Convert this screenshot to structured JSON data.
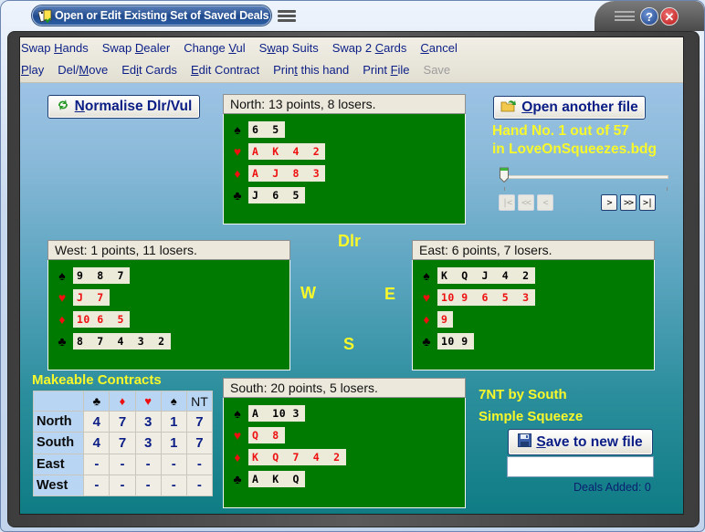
{
  "window": {
    "title": "Open or Edit Existing Set of Saved Deals",
    "help_label": "?",
    "close_label": "✕"
  },
  "menu": {
    "row1": [
      {
        "pre": "Swap ",
        "key": "H",
        "post": "ands"
      },
      {
        "pre": "Swap ",
        "key": "D",
        "post": "ealer"
      },
      {
        "pre": "Change ",
        "key": "V",
        "post": "ul"
      },
      {
        "pre": "S",
        "key": "w",
        "post": "ap Suits"
      },
      {
        "pre": "Swap 2 ",
        "key": "C",
        "post": "ards"
      },
      {
        "pre": "",
        "key": "C",
        "post": "ancel"
      }
    ],
    "row2": [
      {
        "pre": "",
        "key": "P",
        "post": "lay"
      },
      {
        "pre": "Del/",
        "key": "M",
        "post": "ove"
      },
      {
        "pre": "Ed",
        "key": "i",
        "post": "t Cards"
      },
      {
        "pre": "",
        "key": "E",
        "post": "dit Contract"
      },
      {
        "pre": "Prin",
        "key": "t",
        "post": " this hand"
      },
      {
        "pre": "Print ",
        "key": "F",
        "post": "ile"
      },
      {
        "pre": "Save",
        "key": "",
        "post": "",
        "disabled": true
      }
    ]
  },
  "buttons": {
    "normalise": {
      "key": "N",
      "rest": "ormalise Dlr/Vul",
      "icon": "refresh-icon"
    },
    "open": {
      "key": "O",
      "rest": "pen another file",
      "icon": "open-folder-icon"
    },
    "save": {
      "key": "S",
      "rest": "ave to new file",
      "icon": "floppy-disk-icon"
    }
  },
  "file_info": {
    "line1": "Hand No. 1 out of 57",
    "line2": "in LoveOnSqueezes.bdg",
    "current_hand": 1,
    "total_hands": 57,
    "slider_fraction": 0.0
  },
  "nav": [
    {
      "label": "|<",
      "name": "first-hand-button",
      "enabled": false
    },
    {
      "label": "<<",
      "name": "back-many-button",
      "enabled": false
    },
    {
      "label": "<",
      "name": "previous-hand-button",
      "enabled": false
    },
    {
      "label": ">",
      "name": "next-hand-button",
      "enabled": true
    },
    {
      "label": ">>",
      "name": "forward-many-button",
      "enabled": true
    },
    {
      "label": ">|",
      "name": "last-hand-button",
      "enabled": true
    }
  ],
  "suits": [
    {
      "symbol": "♠",
      "name": "spade",
      "color": "black"
    },
    {
      "symbol": "♥",
      "name": "heart",
      "color": "red"
    },
    {
      "symbol": "♦",
      "name": "diamond",
      "color": "red"
    },
    {
      "symbol": "♣",
      "name": "club",
      "color": "black"
    }
  ],
  "hands": {
    "north": {
      "header": "North: 13 points, 8 losers.",
      "cards": [
        "6  5",
        "A  K  4  2",
        "A  J  8  3",
        "J  6  5"
      ]
    },
    "west": {
      "header": "West: 1 points, 11 losers.",
      "cards": [
        "9  8  7",
        "J  7",
        "10 6  5",
        "8  7  4  3  2"
      ]
    },
    "east": {
      "header": "East: 6 points, 7 losers.",
      "cards": [
        "K  Q  J  4  2",
        "10 9  6  5  3",
        "9",
        "10 9"
      ]
    },
    "south": {
      "header": "South: 20 points, 5 losers.",
      "cards": [
        "A  10 3",
        "Q  8",
        "K  Q  7  4  2",
        "A  K  Q"
      ]
    }
  },
  "compass": {
    "dealer": "Dlr",
    "west": "W",
    "east": "E",
    "south": "S"
  },
  "makeable": {
    "title": "Makeable Contracts",
    "columns": [
      {
        "symbol": "♣",
        "color": "black"
      },
      {
        "symbol": "♦",
        "color": "red"
      },
      {
        "symbol": "♥",
        "color": "red"
      },
      {
        "symbol": "♠",
        "color": "black"
      },
      {
        "symbol": "NT",
        "color": "nt"
      }
    ],
    "rows": [
      {
        "player": "North",
        "values": [
          "4",
          "7",
          "3",
          "1",
          "7"
        ]
      },
      {
        "player": "South",
        "values": [
          "4",
          "7",
          "3",
          "1",
          "7"
        ]
      },
      {
        "player": "East",
        "values": [
          "-",
          "-",
          "-",
          "-",
          "-"
        ]
      },
      {
        "player": "West",
        "values": [
          "-",
          "-",
          "-",
          "-",
          "-"
        ]
      }
    ]
  },
  "contract": {
    "line1": "7NT by South",
    "line2": "Simple Squeeze"
  },
  "save_area": {
    "input_value": "",
    "deals_added": "Deals Added: 0"
  }
}
